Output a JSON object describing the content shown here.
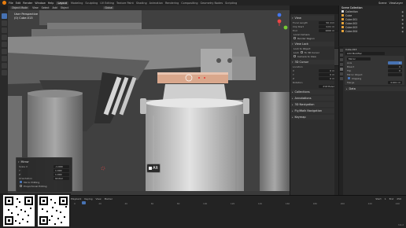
{
  "menu": {
    "items": [
      "File",
      "Edit",
      "Render",
      "Window",
      "Help"
    ],
    "workspaces": [
      "Layout",
      "Modeling",
      "Sculpting",
      "UV Editing",
      "Texture Paint",
      "Shading",
      "Animation",
      "Rendering",
      "Compositing",
      "Geometry Nodes",
      "Scripting"
    ],
    "active_workspace": "Layout",
    "scene": "Scene",
    "view_layer": "ViewLayer"
  },
  "viewport": {
    "header": {
      "mode": "Object Mode",
      "menus": [
        "View",
        "Select",
        "Add",
        "Object"
      ],
      "transform": "Global"
    },
    "overlay": {
      "view_name": "User Perspective",
      "object_label": "(0) Cube.013"
    },
    "key_hint": "Alt"
  },
  "npanel": {
    "view": {
      "title": "View",
      "focal_length_label": "Focal Length",
      "focal_length": "50 mm",
      "clip_start_label": "Clip Start",
      "clip_start": "0.01 m",
      "clip_end_label": "End",
      "clip_end": "1000 m",
      "local_camera_label": "Local Camera",
      "render_region_label": "Render Region"
    },
    "view_lock": {
      "title": "View Lock",
      "lock_to_object_label": "Lock to Object",
      "lock_label": "Lock",
      "to_cursor_label": "To 3D Cursor",
      "camera_label": "Camera to View"
    },
    "cursor": {
      "title": "3D Cursor",
      "location_label": "Location",
      "rotation_label": "Rotation",
      "x": "0 m",
      "y": "0 m",
      "z": "0 m",
      "mode": "XYZ Euler"
    },
    "collections_label": "Collections",
    "annotations_label": "Annotations",
    "navigation_label": "3D Navigation",
    "fly_label": "Fly/Walk Navigation",
    "keymap_label": "Keymap"
  },
  "outliner": {
    "title": "Scene Collection",
    "items": [
      "Collection",
      "Cube",
      "Cube.001",
      "Cube.002",
      "Cube.003",
      "Cube.004"
    ]
  },
  "properties": {
    "object_name": "Cube.013",
    "modifier_title": "Add Modifier",
    "mirror": {
      "name": "Mirror",
      "axis_label": "Axis",
      "bisect_label": "Bisect",
      "flip_label": "Flip",
      "mirror_object_label": "Mirror Object",
      "clipping_label": "Clipping",
      "merge_label": "Merge",
      "merge_value": "0.001 m",
      "data_label": "Data"
    }
  },
  "redo_panel": {
    "title": "Mirror",
    "scale_label": "Scale X",
    "scale_x": "-1.000",
    "y": "1.000",
    "z": "1.000",
    "orientation_label": "Orientation",
    "orientation": "Global",
    "mirror_editing_label": "Mirror Editing",
    "proportional_label": "Proportional Editing"
  },
  "timeline": {
    "menus": [
      "Playback",
      "Keying",
      "View",
      "Marker"
    ],
    "start_label": "Start",
    "start": "1",
    "end_label": "End",
    "end": "250",
    "ticks": [
      "0",
      "20",
      "40",
      "60",
      "80",
      "100",
      "120",
      "140",
      "160",
      "180",
      "200",
      "220",
      "240"
    ]
  },
  "status": {
    "version": "3.6.2"
  }
}
